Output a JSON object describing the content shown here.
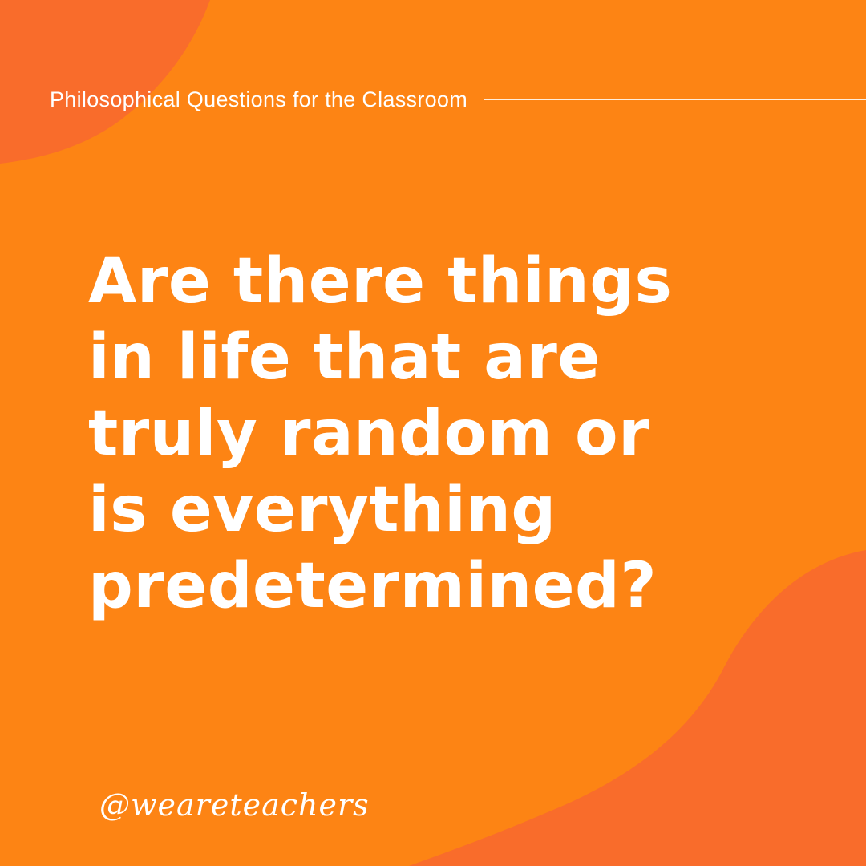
{
  "colors": {
    "background": "#FD8414",
    "accent_blob": "#F96C2B",
    "text": "#FFFFFF"
  },
  "header": {
    "series_title": "Philosophical Questions for the Classroom"
  },
  "question": {
    "lines": [
      "Are there things",
      "in life that are",
      "truly random or",
      "is everything",
      "predetermined?"
    ]
  },
  "footer": {
    "handle": "@weareteachers"
  }
}
